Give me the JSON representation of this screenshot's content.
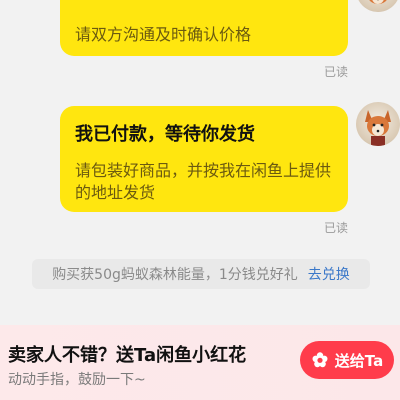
{
  "messages": [
    {
      "subtitle": "请双方沟通及时确认价格",
      "read_status": "已读"
    },
    {
      "title": "我已付款，等待你发货",
      "subtitle": "请包装好商品，并按我在闲鱼上提供的地址发货",
      "read_status": "已读"
    }
  ],
  "promo": {
    "text": "购买获50g蚂蚁森林能量，1分钱兑好礼",
    "link_label": "去兑换"
  },
  "bottom_bar": {
    "title": "卖家人不错？送Ta闲鱼小红花",
    "description": "动动手指，鼓励一下~",
    "button_label": "送给Ta"
  },
  "colors": {
    "bubble": "#ffe60f",
    "button": "#ff3c4b",
    "link": "#3b78c9"
  }
}
